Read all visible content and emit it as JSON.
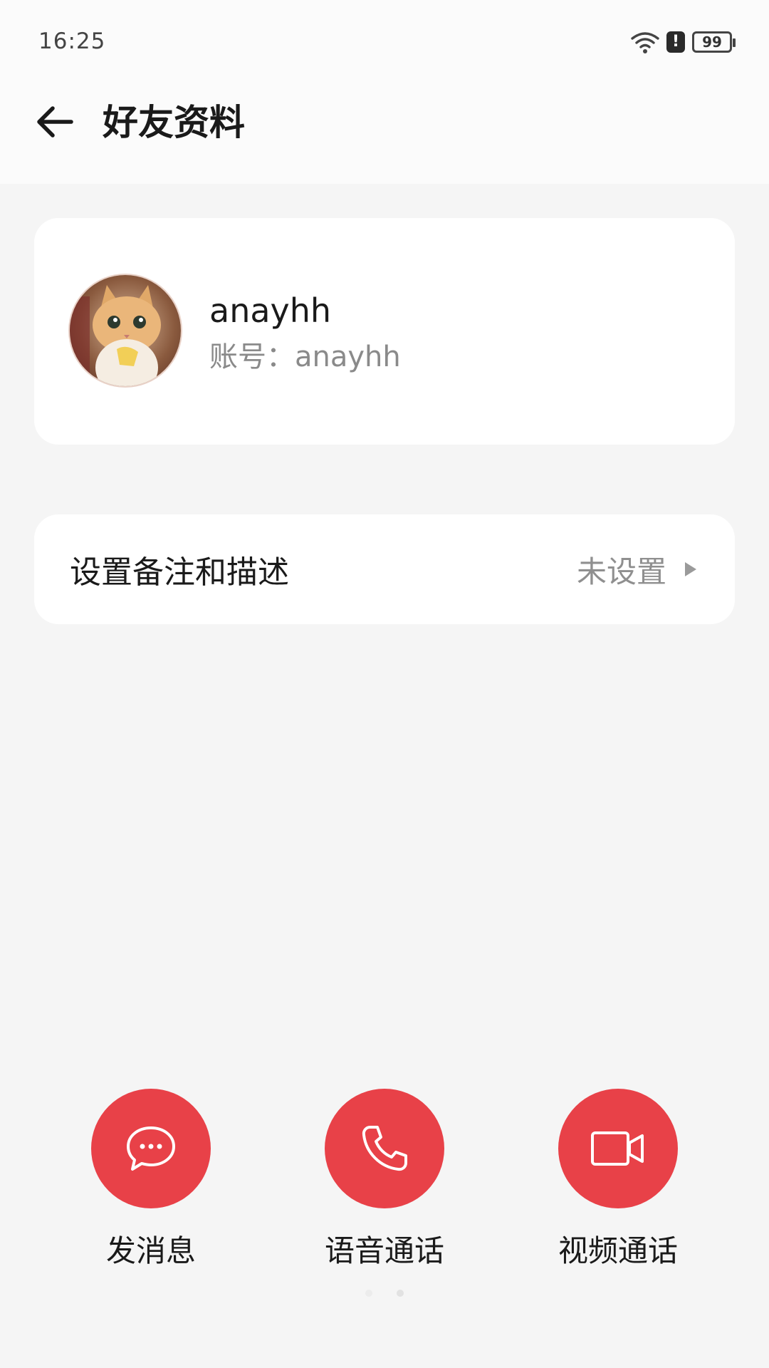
{
  "status_bar": {
    "time": "16:25",
    "battery": "99",
    "alert": "!",
    "icons": [
      "wifi-icon",
      "alert-icon",
      "battery-icon"
    ]
  },
  "header": {
    "title": "好友资料",
    "back_icon": "arrow-left-icon"
  },
  "profile": {
    "name": "anayhh",
    "account": "账号：anayhh"
  },
  "remark": {
    "label": "设置备注和描述",
    "value": "未设置"
  },
  "actions": [
    {
      "label": "发消息",
      "icon": "chat-bubble-icon"
    },
    {
      "label": "语音通话",
      "icon": "phone-icon"
    },
    {
      "label": "视频通话",
      "icon": "video-camera-icon"
    }
  ],
  "colors": {
    "accent": "#e84148",
    "background": "#f5f5f5",
    "card": "#ffffff"
  }
}
